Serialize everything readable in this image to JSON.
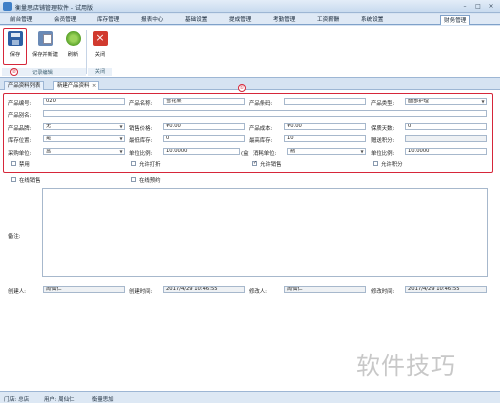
{
  "window": {
    "title": "衡量思店铺管理软件 - 试用版",
    "controls": [
      "–",
      "□",
      "×"
    ]
  },
  "menu": [
    "前台管理",
    "会员管理",
    "库存管理",
    "报表中心",
    "基础设置",
    "提成管理",
    "考勤管理",
    "工资薪酬",
    "系统设置",
    "财务管理"
  ],
  "ribbon": {
    "buttons": {
      "save": "保存",
      "save_new": "保存并新建",
      "refresh": "刷新",
      "close": "关闭"
    },
    "groups": {
      "record_ops": "记录编辑",
      "close": "关闭"
    },
    "marker_left": "②",
    "marker_form": "①"
  },
  "tabs": [
    "产品资料列表",
    "新建产品资料"
  ],
  "tab_close": "×",
  "form": {
    "labels": {
      "code": "产品编号:",
      "name": "产品名称:",
      "barcode": "产品条码:",
      "type": "产品类型:",
      "alias": "产品别名:",
      "brand": "产品品牌:",
      "sale_price": "销售价格:",
      "cost": "产品成本:",
      "warranty": "保质天数:",
      "location": "库存位置:",
      "min_stock": "最低库存:",
      "max_stock": "最高库存:",
      "points": "赠送积分:",
      "purchase_unit": "采购单位:",
      "unit_ratio": "单位比例:",
      "consume_unit": "消耗单位:",
      "unit_ratio2": "单位比例:",
      "memo": "备注:",
      "creator": "创建人:",
      "created_time": "创建时间:",
      "modifier": "修改人:",
      "modified_time": "修改时间:"
    },
    "values": {
      "code": "020",
      "name": "雪花果",
      "barcode": "",
      "type": "面部护理",
      "alias": "",
      "brand": "无",
      "sale_price": "¥0.00",
      "cost": "¥0.00",
      "warranty": "0",
      "location": "是",
      "min_stock": "0",
      "max_stock": "10",
      "points": "",
      "purchase_unit": "盒",
      "unit_ratio": "10.0000",
      "unit_ratio_suffix": "(盒",
      "consume_unit": "瓶",
      "unit_ratio2": "10.0000",
      "creator": "周仙仁",
      "created_time": "2017/4/29 10:46:55",
      "modifier": "周仙仁",
      "modified_time": "2017/4/29 10:46:55"
    },
    "checkboxes": [
      {
        "label": "禁用",
        "checked": false
      },
      {
        "label": "允许打折",
        "checked": false
      },
      {
        "label": "允许销售",
        "checked": true
      },
      {
        "label": "允许积分",
        "checked": false
      },
      {
        "label": "在线销售",
        "checked": false
      },
      {
        "label": "在线预约",
        "checked": false
      }
    ]
  },
  "status": {
    "store": "门店: 总店",
    "user": "用户: 周仙仁",
    "version": "衡量思加"
  },
  "watermark": "软件技巧"
}
